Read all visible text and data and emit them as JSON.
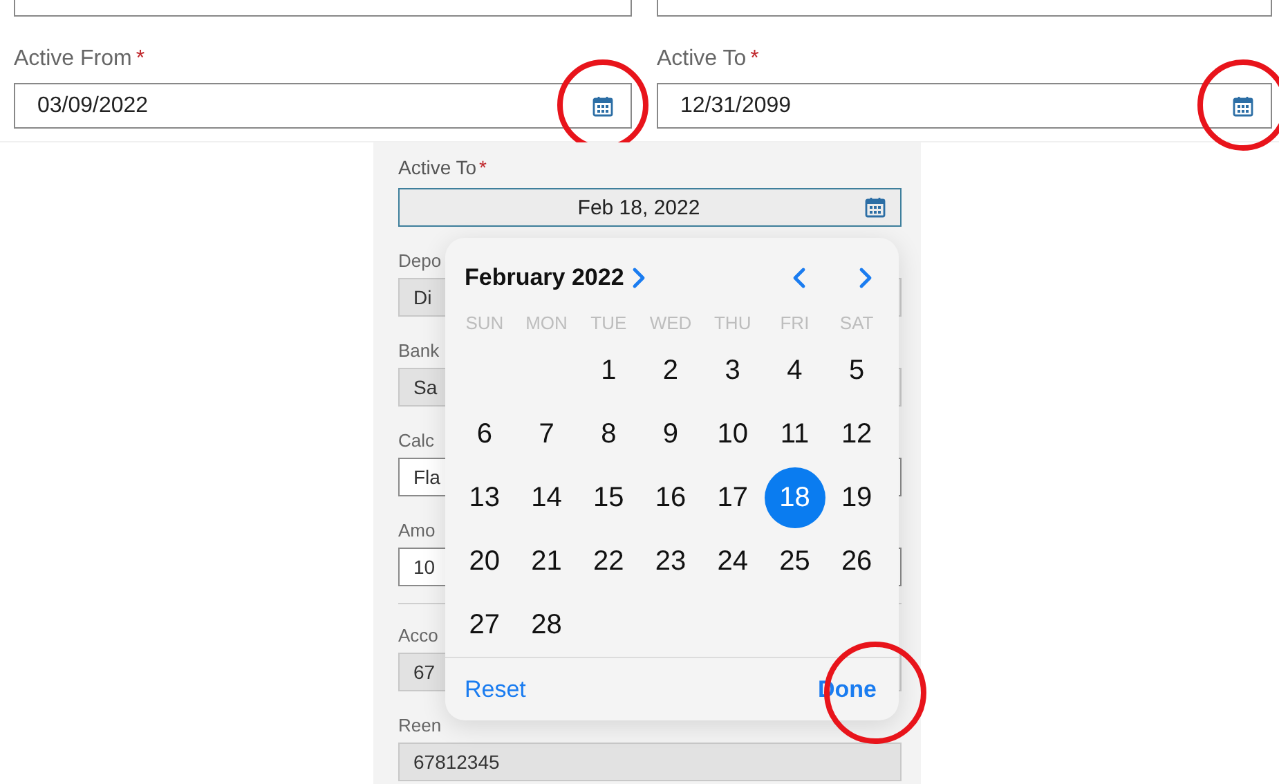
{
  "form": {
    "fields": [
      {
        "label": "Active From",
        "required_mark": "*",
        "value": "03/09/2022",
        "annotated": true
      },
      {
        "label": "Active To",
        "required_mark": "*",
        "value": "12/31/2099",
        "annotated": true
      }
    ]
  },
  "mobile": {
    "field": {
      "label": "Active To",
      "required_mark": "*",
      "value": "Feb 18, 2022"
    },
    "background_fields": [
      {
        "label": "Depo",
        "value": "Di",
        "kind": "readonly"
      },
      {
        "label": "Bank",
        "value": "Sa",
        "kind": "readonly"
      },
      {
        "label": "Calc",
        "value": "Fla",
        "kind": "select"
      },
      {
        "label": "Amo",
        "value": "10",
        "kind": "input"
      },
      {
        "label": "Acco",
        "value": "67",
        "kind": "readonly"
      },
      {
        "label": "Reen",
        "value": "67812345",
        "kind": "readonly"
      }
    ],
    "date_picker": {
      "month": "February 2022",
      "weekdays": [
        "SUN",
        "MON",
        "TUE",
        "WED",
        "THU",
        "FRI",
        "SAT"
      ],
      "weeks": [
        [
          {
            "kind": "empty"
          },
          {
            "kind": "empty"
          },
          {
            "kind": "day",
            "day": "1",
            "selected": false
          },
          {
            "kind": "day",
            "day": "2",
            "selected": false
          },
          {
            "kind": "day",
            "day": "3",
            "selected": false
          },
          {
            "kind": "day",
            "day": "4",
            "selected": false
          },
          {
            "kind": "day",
            "day": "5",
            "selected": false
          }
        ],
        [
          {
            "kind": "day",
            "day": "6",
            "selected": false
          },
          {
            "kind": "day",
            "day": "7",
            "selected": false
          },
          {
            "kind": "day",
            "day": "8",
            "selected": false
          },
          {
            "kind": "day",
            "day": "9",
            "selected": false
          },
          {
            "kind": "day",
            "day": "10",
            "selected": false
          },
          {
            "kind": "day",
            "day": "11",
            "selected": false
          },
          {
            "kind": "day",
            "day": "12",
            "selected": false
          }
        ],
        [
          {
            "kind": "day",
            "day": "13",
            "selected": false
          },
          {
            "kind": "day",
            "day": "14",
            "selected": false
          },
          {
            "kind": "day",
            "day": "15",
            "selected": false
          },
          {
            "kind": "day",
            "day": "16",
            "selected": false
          },
          {
            "kind": "day",
            "day": "17",
            "selected": false
          },
          {
            "kind": "day",
            "day": "18",
            "selected": true
          },
          {
            "kind": "day",
            "day": "19",
            "selected": false
          }
        ],
        [
          {
            "kind": "day",
            "day": "20",
            "selected": false
          },
          {
            "kind": "day",
            "day": "21",
            "selected": false
          },
          {
            "kind": "day",
            "day": "22",
            "selected": false
          },
          {
            "kind": "day",
            "day": "23",
            "selected": false
          },
          {
            "kind": "day",
            "day": "24",
            "selected": false
          },
          {
            "kind": "day",
            "day": "25",
            "selected": false
          },
          {
            "kind": "day",
            "day": "26",
            "selected": false
          }
        ],
        [
          {
            "kind": "day",
            "day": "27",
            "selected": false
          },
          {
            "kind": "day",
            "day": "28",
            "selected": false
          }
        ]
      ],
      "reset": "Reset",
      "done": "Done",
      "done_annotated": true
    }
  }
}
